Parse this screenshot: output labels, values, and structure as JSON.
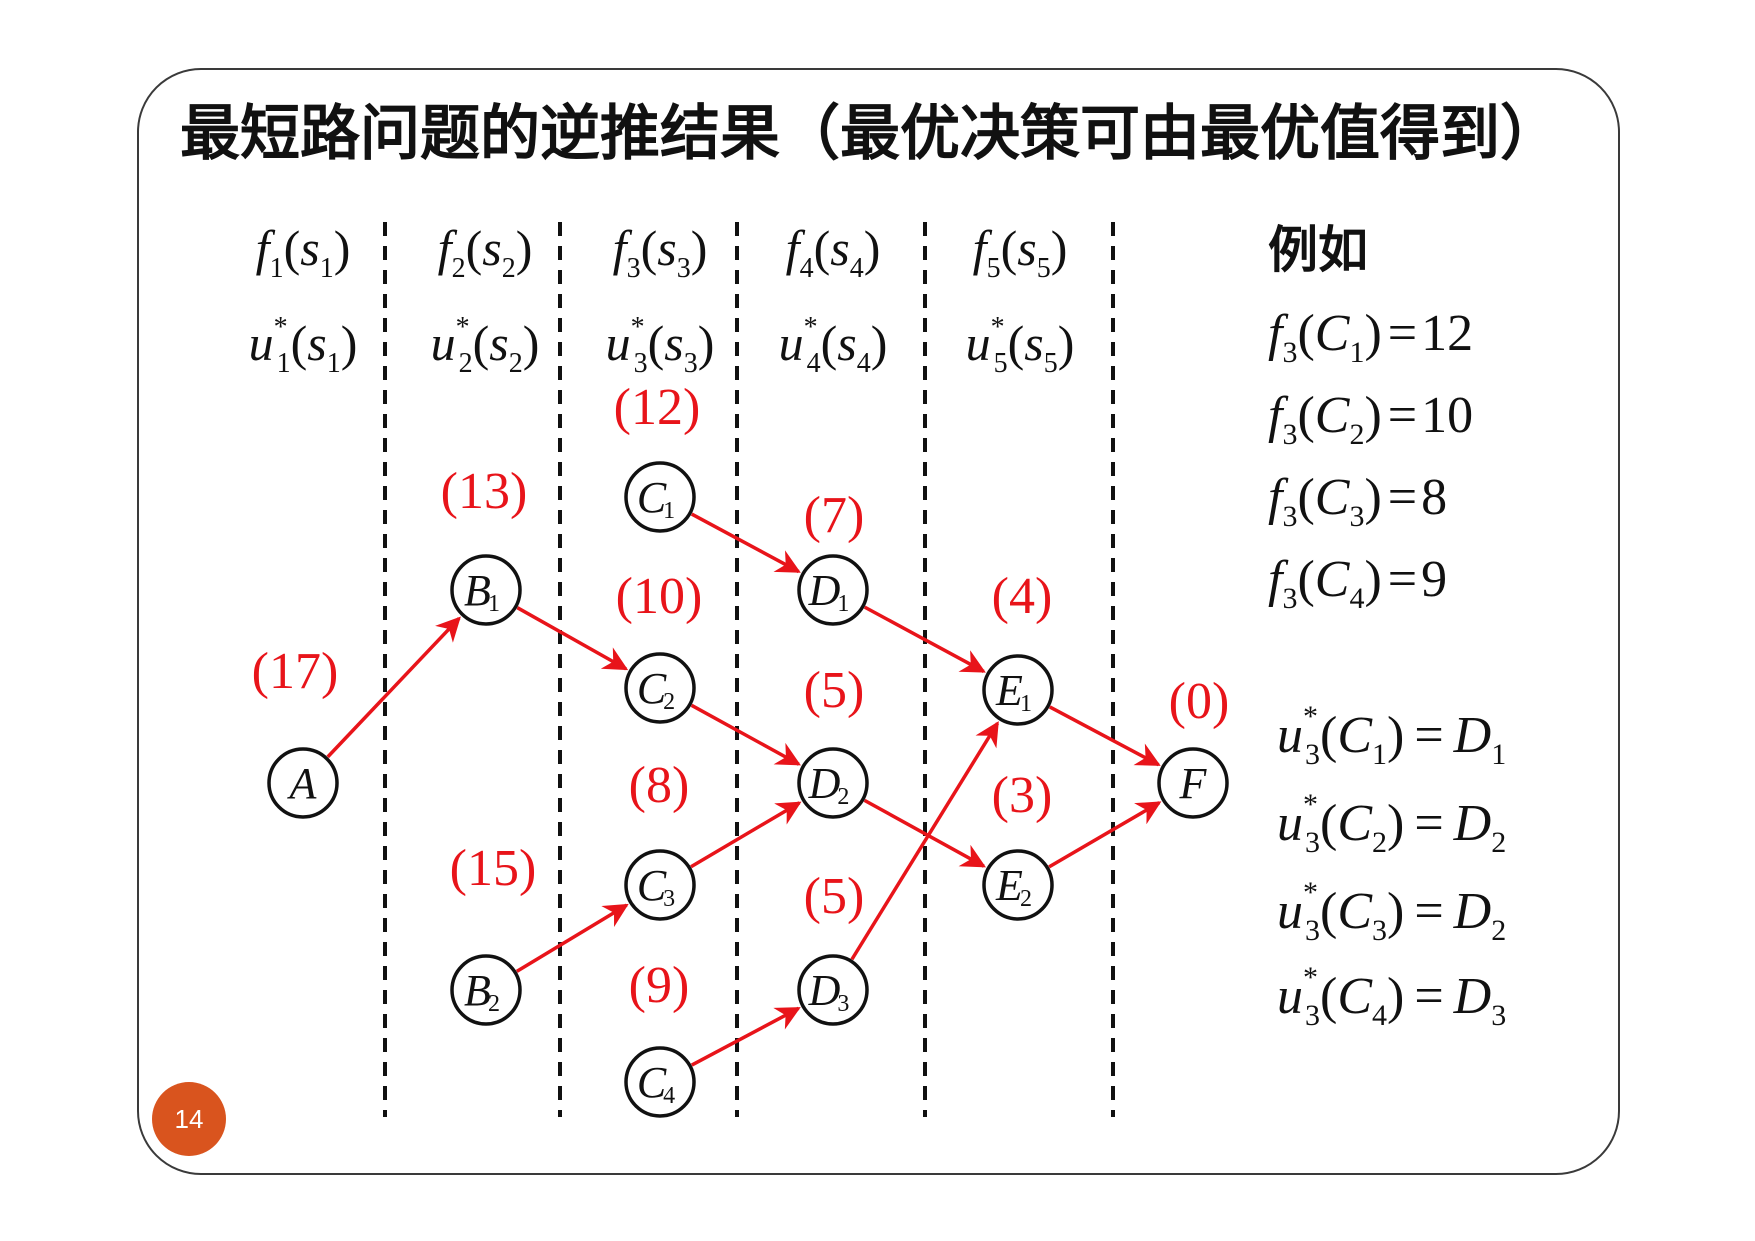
{
  "title": "最短路问题的逆推结果（最优决策可由最优值得到）",
  "page_number": "14",
  "stages": [
    {
      "f": "f",
      "u": "u",
      "sub": "1",
      "s": "s"
    },
    {
      "f": "f",
      "u": "u",
      "sub": "2",
      "s": "s"
    },
    {
      "f": "f",
      "u": "u",
      "sub": "3",
      "s": "s"
    },
    {
      "f": "f",
      "u": "u",
      "sub": "4",
      "s": "s"
    },
    {
      "f": "f",
      "u": "u",
      "sub": "5",
      "s": "s"
    }
  ],
  "star": "*",
  "nodes": [
    {
      "id": "A",
      "label": "A",
      "sub": "",
      "value": "(17)"
    },
    {
      "id": "B1",
      "label": "B",
      "sub": "1",
      "value": "(13)"
    },
    {
      "id": "B2",
      "label": "B",
      "sub": "2",
      "value": "(15)"
    },
    {
      "id": "C1",
      "label": "C",
      "sub": "1",
      "value": "(12)"
    },
    {
      "id": "C2",
      "label": "C",
      "sub": "2",
      "value": "(10)"
    },
    {
      "id": "C3",
      "label": "C",
      "sub": "3",
      "value": "(8)"
    },
    {
      "id": "C4",
      "label": "C",
      "sub": "4",
      "value": "(9)"
    },
    {
      "id": "D1",
      "label": "D",
      "sub": "1",
      "value": "(7)"
    },
    {
      "id": "D2",
      "label": "D",
      "sub": "2",
      "value": "(5)"
    },
    {
      "id": "D3",
      "label": "D",
      "sub": "3",
      "value": "(5)"
    },
    {
      "id": "E1",
      "label": "E",
      "sub": "1",
      "value": "(4)"
    },
    {
      "id": "E2",
      "label": "E",
      "sub": "2",
      "value": "(3)"
    },
    {
      "id": "F",
      "label": "F",
      "sub": "",
      "value": "(0)"
    }
  ],
  "edges": [
    {
      "from": "A",
      "to": "B1"
    },
    {
      "from": "B1",
      "to": "C2"
    },
    {
      "from": "B2",
      "to": "C3"
    },
    {
      "from": "C1",
      "to": "D1"
    },
    {
      "from": "C2",
      "to": "D2"
    },
    {
      "from": "C3",
      "to": "D2"
    },
    {
      "from": "C4",
      "to": "D3"
    },
    {
      "from": "D1",
      "to": "E1"
    },
    {
      "from": "D2",
      "to": "E2"
    },
    {
      "from": "D3",
      "to": "E1"
    },
    {
      "from": "E1",
      "to": "F"
    },
    {
      "from": "E2",
      "to": "F"
    }
  ],
  "example": {
    "heading": "例如",
    "f_values": [
      {
        "f": "f",
        "fsub": "3",
        "arg": "C",
        "argsub": "1",
        "eq": "=",
        "value": "12"
      },
      {
        "f": "f",
        "fsub": "3",
        "arg": "C",
        "argsub": "2",
        "eq": "=",
        "value": "10"
      },
      {
        "f": "f",
        "fsub": "3",
        "arg": "C",
        "argsub": "3",
        "eq": "=",
        "value": "8"
      },
      {
        "f": "f",
        "fsub": "3",
        "arg": "C",
        "argsub": "4",
        "eq": "=",
        "value": "9"
      }
    ],
    "u_values": [
      {
        "u": "u",
        "usub": "3",
        "arg": "C",
        "argsub": "1",
        "eq": "=",
        "res": "D",
        "ressub": "1"
      },
      {
        "u": "u",
        "usub": "3",
        "arg": "C",
        "argsub": "2",
        "eq": "=",
        "res": "D",
        "ressub": "2"
      },
      {
        "u": "u",
        "usub": "3",
        "arg": "C",
        "argsub": "3",
        "eq": "=",
        "res": "D",
        "ressub": "2"
      },
      {
        "u": "u",
        "usub": "3",
        "arg": "C",
        "argsub": "4",
        "eq": "=",
        "res": "D",
        "ressub": "3"
      }
    ]
  },
  "colors": {
    "path": "#e8141a",
    "badge": "#d9541e",
    "ink": "#111111"
  }
}
